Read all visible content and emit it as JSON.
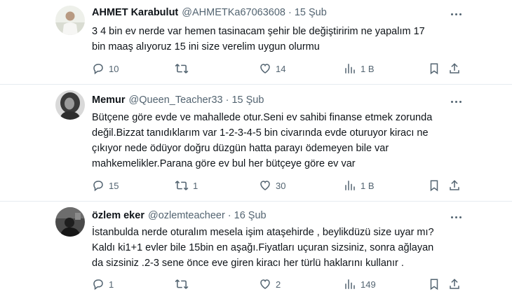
{
  "tweets": [
    {
      "name": "AHMET Karabulut",
      "handle": "@AHMETKa67063608",
      "dot": "·",
      "date": "15 Şub",
      "lines": [
        "3 4 bin ev nerde var hemen tasinacam şehir ble değiştiririm ne yapalım 17",
        "bin maaş alıyoruz 15 ini size verelim uygun olurmu"
      ],
      "replies": "10",
      "retweets": "",
      "likes": "14",
      "views": "1 B"
    },
    {
      "name": "Memur",
      "handle": "@Queen_Teacher33",
      "dot": "·",
      "date": "15 Şub",
      "lines": [
        "Bütçene göre evde ve mahallede otur.Seni ev sahibi finanse etmek zorunda",
        "değil.Bizzat tanıdıklarım var 1-2-3-4-5 bin civarında evde oturuyor kiracı ne",
        "çıkıyor nede ödüyor doğru düzgün hatta parayı ödemeyen bile var",
        "mahkemelikler.Parana göre ev bul her bütçeye göre ev var"
      ],
      "replies": "15",
      "retweets": "1",
      "likes": "30",
      "views": "1 B"
    },
    {
      "name": "özlem eker",
      "handle": "@ozlemteacheer",
      "dot": "·",
      "date": "16 Şub",
      "lines": [
        "İstanbulda nerde oturalım mesela işim ataşehirde , beylikdüzü size uyar mı?",
        "Kaldı ki1+1 evler bile 15bin en aşağı.Fiyatları uçuran sizsiniz, sonra ağlayan",
        "da sizsiniz .2-3 sene önce eve giren kiracı her türlü haklarını kullanır ."
      ],
      "replies": "1",
      "retweets": "",
      "likes": "2",
      "views": "149"
    }
  ],
  "colors": {
    "text": "#0f1419",
    "muted": "#536471",
    "divider": "#e6ecf0"
  },
  "icons": [
    "reply-icon",
    "retweet-icon",
    "like-icon",
    "views-icon",
    "bookmark-icon",
    "share-icon",
    "more-icon"
  ]
}
